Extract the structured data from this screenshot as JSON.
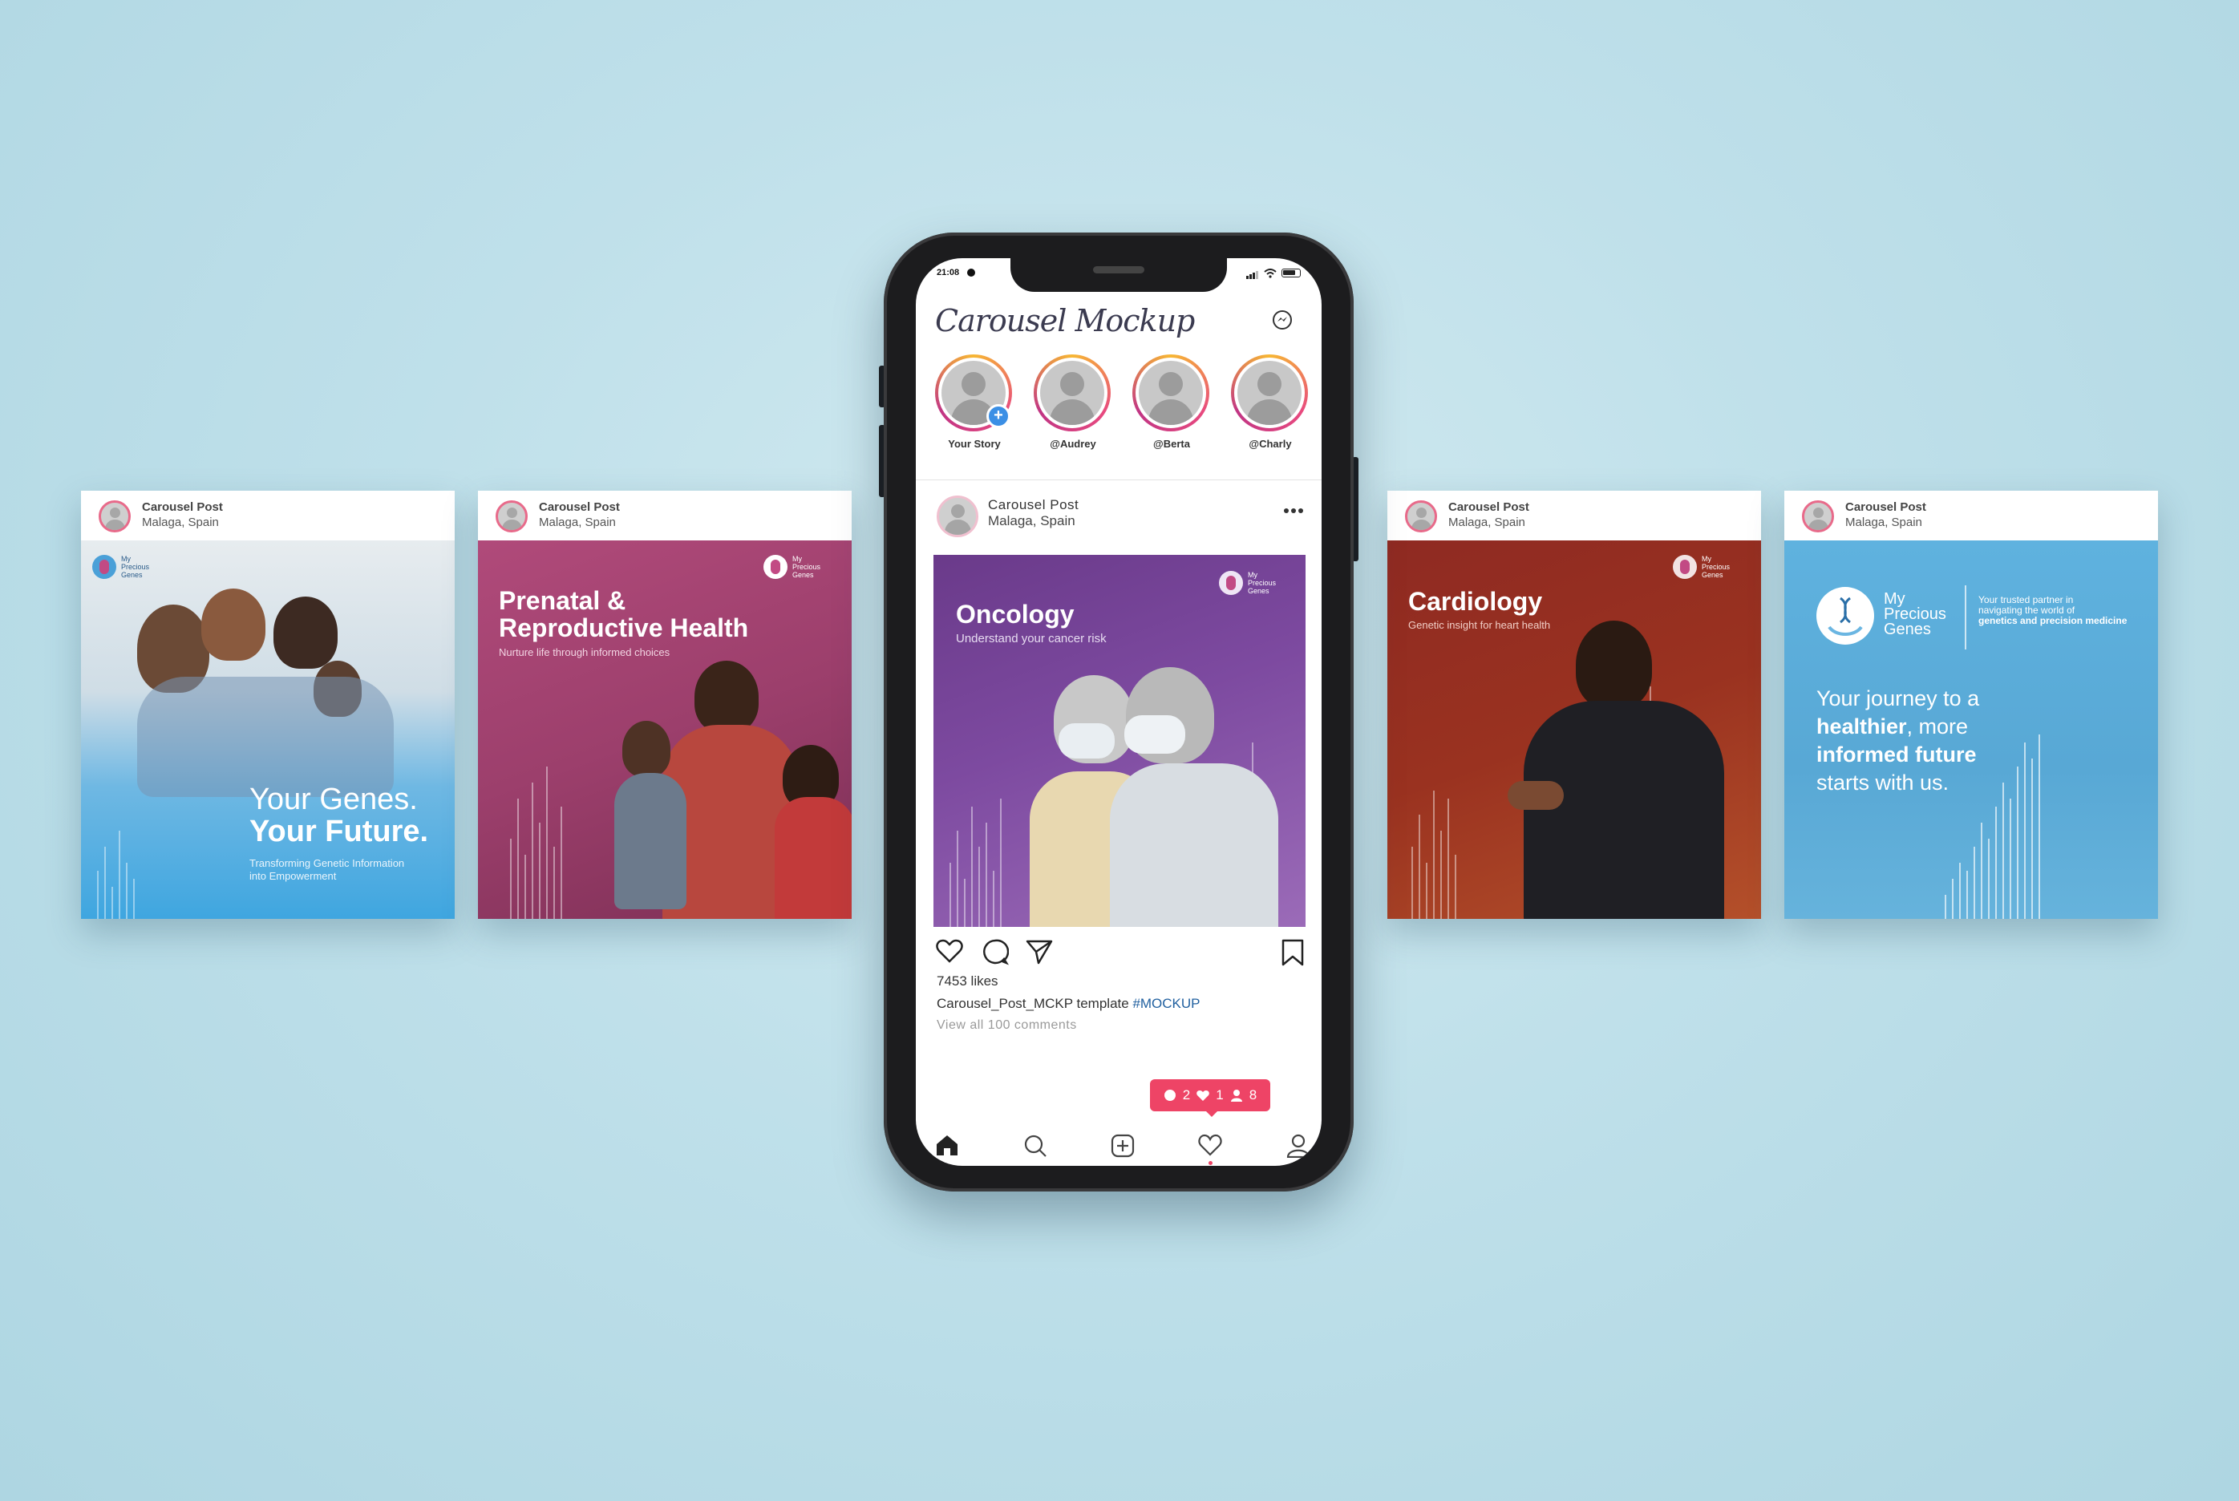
{
  "cards": [
    {
      "header_title": "Carousel Post",
      "header_sub": "Malaga, Spain",
      "brand": "My Precious Genes",
      "line1": "Your Genes.",
      "line2": "Your Future.",
      "tagline": "Transforming Genetic Information into Empowerment"
    },
    {
      "header_title": "Carousel Post",
      "header_sub": "Malaga, Spain",
      "brand": "My Precious Genes",
      "title1": "Prenatal &",
      "title2": "Reproductive Health",
      "tagline": "Nurture life through informed choices"
    },
    {
      "header_title": "Carousel Post",
      "header_sub": "Malaga, Spain",
      "brand": "My Precious Genes",
      "title": "Cardiology",
      "tagline": "Genetic insight for heart health"
    },
    {
      "header_title": "Carousel Post",
      "header_sub": "Malaga, Spain",
      "brand_l1": "My",
      "brand_l2": "Precious",
      "brand_l3": "Genes",
      "partner_l1": "Your trusted partner in",
      "partner_l2": "navigating the world of",
      "partner_l3": "genetics and precision medicine",
      "j1": "Your journey to a",
      "j2a": "healthier",
      "j2b": ", more",
      "j3": "informed future",
      "j4": "starts with us."
    }
  ],
  "phone": {
    "status": {
      "time": "21:08"
    },
    "app_title": "Carousel Mockup",
    "stories": [
      {
        "label": "Your Story"
      },
      {
        "label": "@Audrey"
      },
      {
        "label": "@Berta"
      },
      {
        "label": "@Charly"
      }
    ],
    "post": {
      "title": "Carousel Post",
      "location": "Malaga, Spain",
      "image_title": "Oncology",
      "image_sub": "Understand your cancer risk",
      "brand": "My Precious Genes",
      "likes": "7453 likes",
      "caption_user": "Carousel_Post_MCKP",
      "caption_text": " template ",
      "caption_tag": "#MOCKUP",
      "comments": "View all 100 comments"
    },
    "notification": {
      "comments": "2",
      "likes": "1",
      "follows": "8"
    },
    "colors": {
      "accent": "#ee4466",
      "tag": "#1f5f9f"
    }
  }
}
